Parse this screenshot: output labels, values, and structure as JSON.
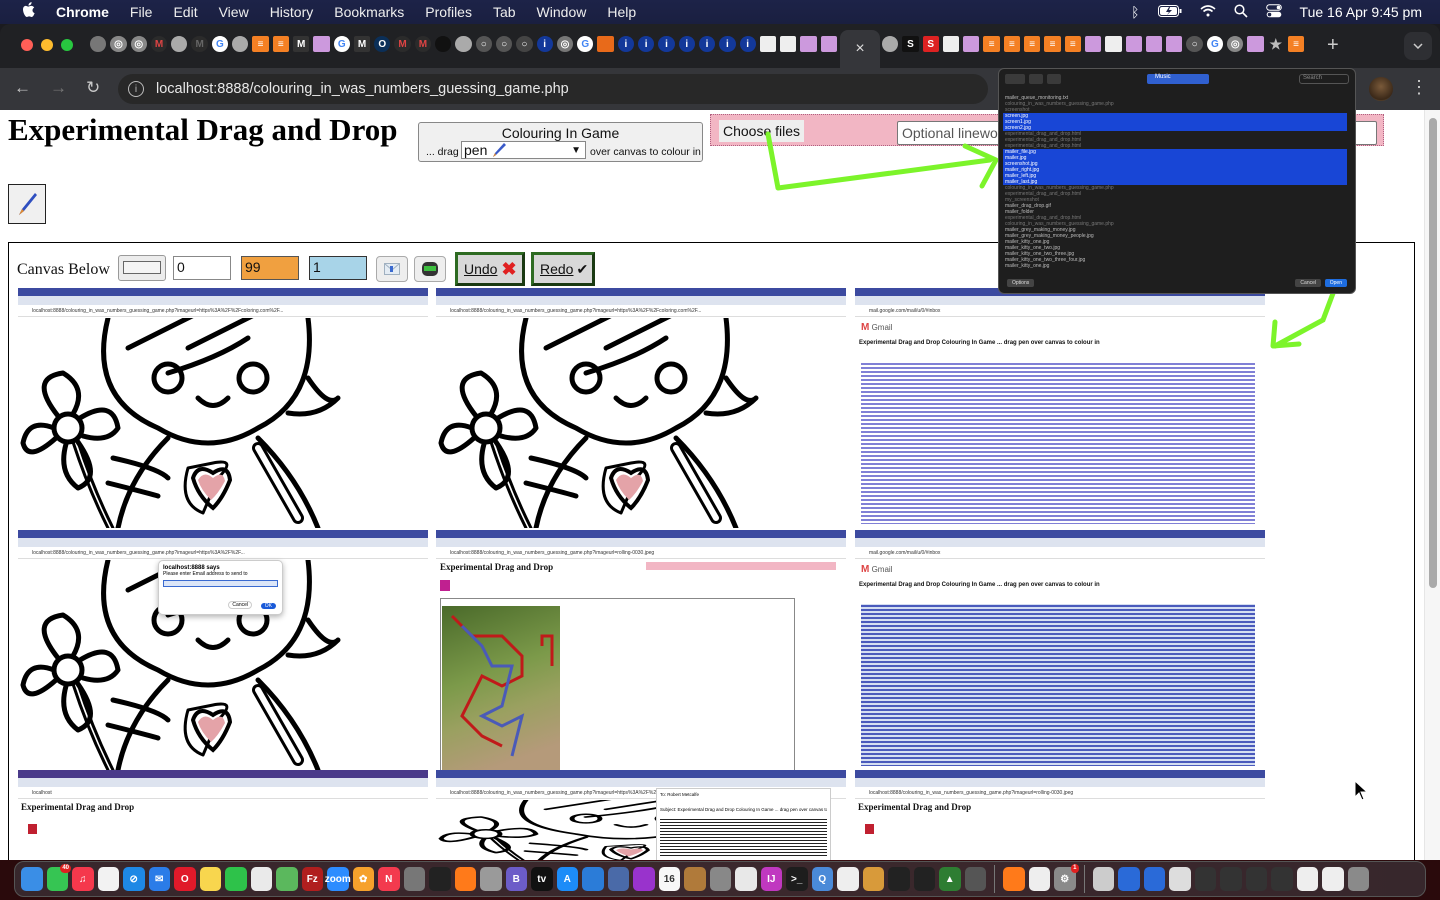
{
  "menubar": {
    "app": "Chrome",
    "items": [
      "File",
      "Edit",
      "View",
      "History",
      "Bookmarks",
      "Profiles",
      "Tab",
      "Window",
      "Help"
    ],
    "clock": "Tue 16 Apr  9:45 pm",
    "status_icons": [
      "bluetooth-icon",
      "battery-icon",
      "wifi-icon",
      "spotlight-icon",
      "control-center-icon"
    ]
  },
  "browser": {
    "url": "localhost:8888/colouring_in_was_numbers_guessing_game.php",
    "active_tab_close": "×",
    "new_tab": "+",
    "pinned_tabs_left": [
      {
        "icon": "generic",
        "color": "#777"
      },
      {
        "icon": "chrome",
        "color": "#888"
      },
      {
        "icon": "chrome",
        "color": "#888"
      },
      {
        "icon": "gmail",
        "color": "#d44"
      },
      {
        "icon": "mamp",
        "color": "#aaa"
      },
      {
        "icon": "gmail",
        "color": "#666"
      },
      {
        "icon": "google",
        "color": "#4285f4"
      },
      {
        "icon": "mamp",
        "color": "#aaa"
      },
      {
        "icon": "stackoverflow",
        "color": "#f48024"
      },
      {
        "icon": "stackoverflow",
        "color": "#f48024"
      },
      {
        "icon": "m",
        "color": "#333"
      },
      {
        "icon": "pencil",
        "color": "#c9d"
      },
      {
        "icon": "google",
        "color": "#4285f4"
      },
      {
        "icon": "m",
        "color": "#333"
      },
      {
        "icon": "o",
        "color": "#0b2f58"
      },
      {
        "icon": "gmail",
        "color": "#d44"
      },
      {
        "icon": "gmail",
        "color": "#d44"
      },
      {
        "icon": "accessibility",
        "color": "#111"
      },
      {
        "icon": "mamp",
        "color": "#aaa"
      },
      {
        "icon": "circle",
        "color": "#555"
      },
      {
        "icon": "circle",
        "color": "#555"
      },
      {
        "icon": "circle",
        "color": "#444"
      },
      {
        "icon": "info",
        "color": "#13389a"
      },
      {
        "icon": "chrome",
        "color": "#777"
      },
      {
        "icon": "google",
        "color": "#4285f4"
      },
      {
        "icon": "orange-doc",
        "color": "#e86a1a"
      },
      {
        "icon": "info",
        "color": "#13389a"
      },
      {
        "icon": "info",
        "color": "#13389a"
      },
      {
        "icon": "info",
        "color": "#13389a"
      },
      {
        "icon": "info",
        "color": "#13389a"
      },
      {
        "icon": "info",
        "color": "#13389a"
      },
      {
        "icon": "info",
        "color": "#13389a"
      },
      {
        "icon": "info",
        "color": "#13389a"
      },
      {
        "icon": "dots",
        "color": "#eee"
      },
      {
        "icon": "dots",
        "color": "#eee"
      },
      {
        "icon": "pencil",
        "color": "#c9d"
      },
      {
        "icon": "pencil",
        "color": "#c9d"
      }
    ],
    "pinned_tabs_right": [
      {
        "icon": "mamp",
        "color": "#aaa"
      },
      {
        "icon": "s",
        "color": "#111"
      },
      {
        "icon": "S",
        "color": "#d22"
      },
      {
        "icon": "dots",
        "color": "#eee"
      },
      {
        "icon": "pencil",
        "color": "#c9d"
      },
      {
        "icon": "stackoverflow",
        "color": "#f48024"
      },
      {
        "icon": "stackoverflow",
        "color": "#f48024"
      },
      {
        "icon": "stackoverflow",
        "color": "#f48024"
      },
      {
        "icon": "stackoverflow",
        "color": "#f48024"
      },
      {
        "icon": "stackoverflow",
        "color": "#f48024"
      },
      {
        "icon": "pencil",
        "color": "#c9d"
      },
      {
        "icon": "pencil",
        "color": "#eee"
      },
      {
        "icon": "pencil",
        "color": "#c9d"
      },
      {
        "icon": "pencil",
        "color": "#c9d"
      },
      {
        "icon": "pencil",
        "color": "#c9d"
      },
      {
        "icon": "circle",
        "color": "#555"
      },
      {
        "icon": "google",
        "color": "#4285f4"
      },
      {
        "icon": "chrome",
        "color": "#888"
      },
      {
        "icon": "pencil",
        "color": "#c9d"
      },
      {
        "icon": "star",
        "color": "#aaa"
      },
      {
        "icon": "stackoverflow",
        "color": "#f48024"
      }
    ]
  },
  "page": {
    "title": "Experimental Drag and Drop",
    "game": {
      "title": "Colouring In Game",
      "drag_prefix": "... drag",
      "tool_selected": "pen",
      "drag_suffix": "over canvas to colour in"
    },
    "upload": {
      "choose_files_label": "Choose files",
      "lineart_placeholder": "Optional linework or postcard or other usage background image URL"
    },
    "canvas": {
      "label": "Canvas Below",
      "x_value": "0",
      "size_value": "99",
      "opacity_value": "1",
      "undo_label": "Undo",
      "redo_label": "Redo",
      "undo_icon": "✖",
      "redo_icon": "✔"
    },
    "thumbnails": [
      {
        "kind": "colouring",
        "url": "localhost:8888/colouring_in_was_numbers_guessing_game.php?imageurl=https%3A%2F%2Fcoloring.com%2F..."
      },
      {
        "kind": "colouring",
        "url": "localhost:8888/colouring_in_was_numbers_guessing_game.php?imageurl=https%3A%2F%2Fcoloring.com%2F..."
      },
      {
        "kind": "gmail",
        "gmail_label": "Gmail",
        "subject": "Experimental Drag and Drop Colouring In Game ... drag pen over canvas to colour in",
        "url": "mail.google.com/mail/u/0/#inbox"
      },
      {
        "kind": "colouring-dialog",
        "dialog_title": "localhost:8888 says",
        "dialog_msg": "Please enter Email address to send to",
        "dialog_ok": "OK",
        "dialog_cancel": "Cancel",
        "url": "localhost:8888/colouring_in_was_numbers_guessing_game.php?imageurl=https%3A%2F%2F..."
      },
      {
        "kind": "photo",
        "mini_title": "Experimental Drag and Drop",
        "url": "localhost:8888/colouring_in_was_numbers_guessing_game.php?imageurl=rolling-0030.jpeg"
      },
      {
        "kind": "gmail",
        "gmail_label": "Gmail",
        "subject": "Experimental Drag and Drop Colouring In Game ... drag pen over canvas to colour in",
        "url": "mail.google.com/mail/u/0/#inbox"
      },
      {
        "kind": "safari",
        "mini_title": "Experimental Drag and Drop",
        "url": "localhost"
      },
      {
        "kind": "compose",
        "compose_subject": "Subject: Experimental Drag and Drop Colouring In Game ... drag pen over canvas to colour in",
        "compose_to": "To: Robert Metcalfe",
        "url": "localhost:8888/colouring_in_was_numbers_guessing_game.php?imageurl=https%3A%2F%2F..."
      },
      {
        "kind": "chrome-mini",
        "mini_title": "Experimental Drag and Drop",
        "url": "localhost:8888/colouring_in_was_numbers_guessing_game.php?imageurl=rolling-0030.jpeg"
      }
    ]
  },
  "file_dialog": {
    "location": "Music",
    "search_placeholder": "Search",
    "options_label": "Options",
    "cancel_label": "Cancel",
    "open_label": "Open",
    "rows": [
      {
        "name": "mailer_queue_monitoring.txt",
        "selected": false,
        "dim": false
      },
      {
        "name": "colouring_in_was_numbers_guessing_game.php",
        "selected": false,
        "dim": true
      },
      {
        "name": "screenshot",
        "selected": false,
        "dim": true
      },
      {
        "name": "screen.jpg",
        "selected": true,
        "dim": false
      },
      {
        "name": "screen1.jpg",
        "selected": true,
        "dim": false
      },
      {
        "name": "screen2.jpg",
        "selected": true,
        "dim": false
      },
      {
        "name": "experimental_drag_and_drop.html",
        "selected": false,
        "dim": true
      },
      {
        "name": "experimental_drag_and_drop.html",
        "selected": false,
        "dim": true
      },
      {
        "name": "experimental_drag_and_drop.html",
        "selected": false,
        "dim": true
      },
      {
        "name": "mailer_file.jpg",
        "selected": true,
        "dim": false
      },
      {
        "name": "mailer.jpg",
        "selected": true,
        "dim": false
      },
      {
        "name": "screenshot.jpg",
        "selected": true,
        "dim": false
      },
      {
        "name": "mailer_right.jpg",
        "selected": true,
        "dim": false
      },
      {
        "name": "mailer_left.jpg",
        "selected": true,
        "dim": false
      },
      {
        "name": "mailer_last.jpg",
        "selected": true,
        "dim": false
      },
      {
        "name": "colouring_in_was_numbers_guessing_game.php",
        "selected": false,
        "dim": true
      },
      {
        "name": "experimental_drag_and_drop.html",
        "selected": false,
        "dim": true
      },
      {
        "name": "my_screenshot",
        "selected": false,
        "dim": true
      },
      {
        "name": "mailer_drag_drop.gif",
        "selected": false,
        "dim": false
      },
      {
        "name": "mailer_folder",
        "selected": false,
        "dim": false
      },
      {
        "name": "experimental_drag_and_drop.html",
        "selected": false,
        "dim": true
      },
      {
        "name": "colouring_in_was_numbers_guessing_game.php",
        "selected": false,
        "dim": true
      },
      {
        "name": "mailer_grey_making_money.jpg",
        "selected": false,
        "dim": false
      },
      {
        "name": "mailer_grey_making_money_people.jpg",
        "selected": false,
        "dim": false
      },
      {
        "name": "mailer_kitty_one.jpg",
        "selected": false,
        "dim": false
      },
      {
        "name": "mailer_kitty_one_two.jpg",
        "selected": false,
        "dim": false
      },
      {
        "name": "mailer_kitty_one_two_three.jpg",
        "selected": false,
        "dim": false
      },
      {
        "name": "mailer_kitty_one_two_three_four.jpg",
        "selected": false,
        "dim": false
      },
      {
        "name": "mailer_kitty_one.jpg",
        "selected": false,
        "dim": false
      }
    ]
  },
  "dock": {
    "apps": [
      {
        "name": "finder",
        "color": "#3a8ee6",
        "glyph": ""
      },
      {
        "name": "messages",
        "color": "#36c553",
        "glyph": "",
        "badge": "40"
      },
      {
        "name": "music",
        "color": "#f5384c",
        "glyph": "♫"
      },
      {
        "name": "reminders",
        "color": "#f2f2f2",
        "glyph": ""
      },
      {
        "name": "safari",
        "color": "#1e88e5",
        "glyph": "⊘"
      },
      {
        "name": "mail",
        "color": "#2b7ce8",
        "glyph": "✉"
      },
      {
        "name": "opera",
        "color": "#e01a2a",
        "glyph": "O"
      },
      {
        "name": "notes",
        "color": "#f8d64e",
        "glyph": ""
      },
      {
        "name": "facetime",
        "color": "#2ec24a",
        "glyph": ""
      },
      {
        "name": "libreoffice",
        "color": "#eaeaea",
        "glyph": ""
      },
      {
        "name": "maps",
        "color": "#5bb85d",
        "glyph": ""
      },
      {
        "name": "filezilla",
        "color": "#b01e1e",
        "glyph": "Fz"
      },
      {
        "name": "zoom",
        "color": "#2d8cff",
        "glyph": "zoom"
      },
      {
        "name": "photos",
        "color": "#f6a12c",
        "glyph": "✿"
      },
      {
        "name": "news",
        "color": "#f33a4e",
        "glyph": "N"
      },
      {
        "name": "gimp",
        "color": "#777",
        "glyph": ""
      },
      {
        "name": "terminal-green",
        "color": "#222",
        "glyph": ""
      },
      {
        "name": "firefox",
        "color": "#ff7a1a",
        "glyph": ""
      },
      {
        "name": "launchpad",
        "color": "#9a9a9a",
        "glyph": ""
      },
      {
        "name": "bbedit",
        "color": "#6c5cc8",
        "glyph": "B"
      },
      {
        "name": "apple-tv",
        "color": "#111",
        "glyph": "tv"
      },
      {
        "name": "app-store",
        "color": "#1d8cf8",
        "glyph": "A"
      },
      {
        "name": "xcode",
        "color": "#2b7cd8",
        "glyph": ""
      },
      {
        "name": "preview",
        "color": "#4a6aa8",
        "glyph": ""
      },
      {
        "name": "podcasts",
        "color": "#9933cc",
        "glyph": ""
      },
      {
        "name": "calendar",
        "color": "#f8f8f8",
        "glyph": "16"
      },
      {
        "name": "contacts",
        "color": "#b07a3a",
        "glyph": ""
      },
      {
        "name": "calculator",
        "color": "#888",
        "glyph": ""
      },
      {
        "name": "chrome",
        "color": "#e8e8e8",
        "glyph": ""
      },
      {
        "name": "intellij",
        "color": "#c038c0",
        "glyph": "IJ"
      },
      {
        "name": "terminal",
        "color": "#1d1d1d",
        "glyph": ">_"
      },
      {
        "name": "quicktime",
        "color": "#4a8ad8",
        "glyph": "Q"
      },
      {
        "name": "libreoffice-2",
        "color": "#eee",
        "glyph": ""
      },
      {
        "name": "paintbrush",
        "color": "#d89a3a",
        "glyph": ""
      },
      {
        "name": "inkscape",
        "color": "#222",
        "glyph": ""
      },
      {
        "name": "console",
        "color": "#222",
        "glyph": ""
      },
      {
        "name": "cmake",
        "color": "#2e7d32",
        "glyph": "▲"
      },
      {
        "name": "mamp",
        "color": "#555",
        "glyph": ""
      }
    ],
    "apps_right": [
      {
        "name": "firefox-2",
        "color": "#ff7a1a",
        "glyph": ""
      },
      {
        "name": "textedit",
        "color": "#eee",
        "glyph": ""
      },
      {
        "name": "system-settings",
        "color": "#8a8a8a",
        "glyph": "⚙",
        "badge": "1"
      }
    ],
    "folders": [
      {
        "name": "image-capture",
        "color": "#ccc"
      },
      {
        "name": "globe",
        "color": "#2a6ad8"
      },
      {
        "name": "globe-2",
        "color": "#2a6ad8"
      },
      {
        "name": "window-1",
        "color": "#ddd"
      },
      {
        "name": "window-2",
        "color": "#333"
      },
      {
        "name": "window-3",
        "color": "#333"
      },
      {
        "name": "window-4",
        "color": "#333"
      },
      {
        "name": "window-5",
        "color": "#333"
      },
      {
        "name": "doc-1",
        "color": "#eee"
      },
      {
        "name": "doc-2",
        "color": "#eee"
      },
      {
        "name": "trash",
        "color": "#8a8a8a"
      }
    ]
  }
}
